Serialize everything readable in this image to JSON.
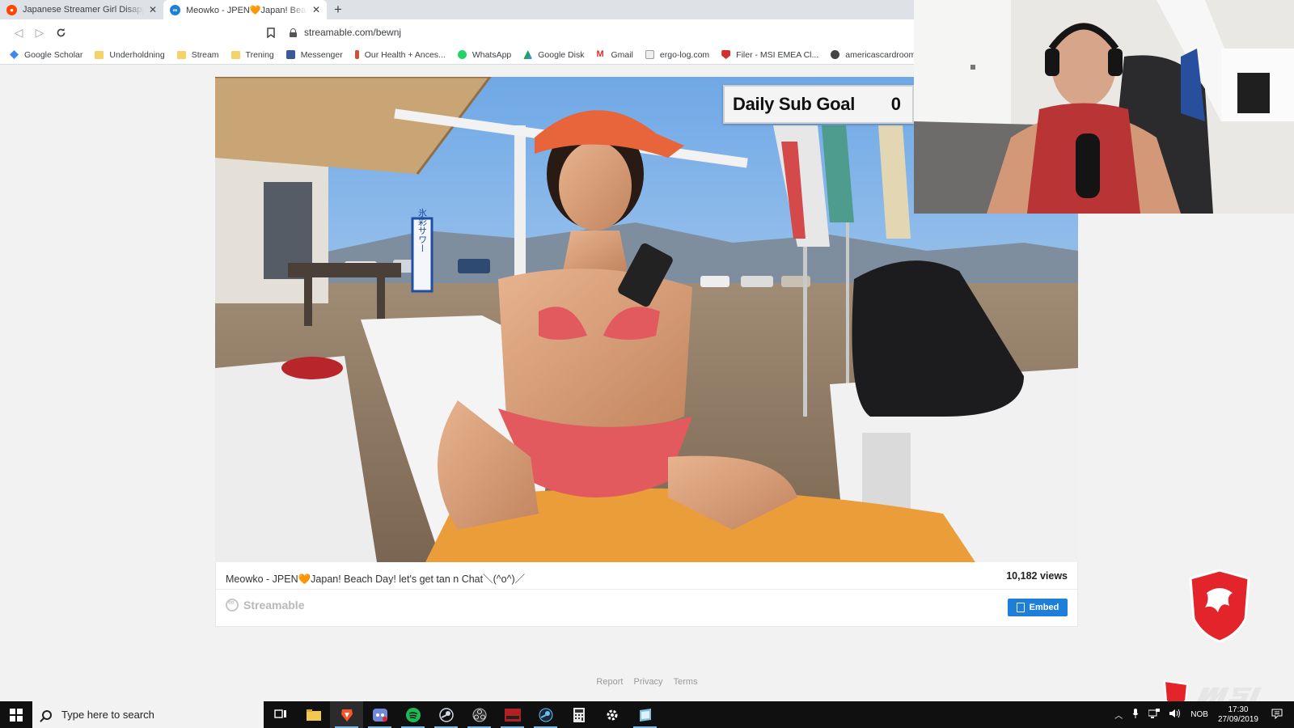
{
  "tabs": [
    {
      "title": "Japanese Streamer Girl Disappointed With Fans",
      "favicon_color": "#ff4500",
      "active": false
    },
    {
      "title": "Meowko - JPEN🧡Japan! Beach Day",
      "favicon_color": "#1d7fd9",
      "active": true
    }
  ],
  "address": {
    "url": "streamable.com/bewnj"
  },
  "bookmarks": [
    {
      "label": "Google Scholar",
      "color": "#4285f4"
    },
    {
      "label": "Underholdning",
      "color": "#f6d26b",
      "folder": true
    },
    {
      "label": "Stream",
      "color": "#f6d26b",
      "folder": true
    },
    {
      "label": "Trening",
      "color": "#f6d26b",
      "folder": true
    },
    {
      "label": "Messenger",
      "color": "#3b5998"
    },
    {
      "label": "Our Health + Ances...",
      "color": "#d1502e"
    },
    {
      "label": "WhatsApp",
      "color": "#25d366"
    },
    {
      "label": "Google Disk",
      "color": "#1fa463"
    },
    {
      "label": "Gmail",
      "color": "#d93025"
    },
    {
      "label": "ergo-log.com",
      "color": "#9e9e9e"
    },
    {
      "label": "Filer - MSI EMEA Cl...",
      "color": "#d32f2f"
    },
    {
      "label": "americascardroom",
      "color": "#444444"
    }
  ],
  "video": {
    "title": "Meowko - JPEN🧡Japan! Beach Day! let's get tan n Chat＼(^o^)／",
    "views": "10,182 views",
    "brand": "Streamable",
    "embed_label": "Embed",
    "sign_text": "氷彩サワー"
  },
  "overlay": {
    "label": "Daily Sub Goal",
    "value": "0"
  },
  "footer": {
    "report": "Report",
    "privacy": "Privacy",
    "terms": "Terms"
  },
  "taskbar": {
    "search_placeholder": "Type here to search",
    "language": "NOB",
    "time": "17:30",
    "date": "27/09/2019"
  },
  "colors": {
    "accent": "#1d7fd9",
    "taskbar": "#101010",
    "msi_red": "#e3242b"
  }
}
